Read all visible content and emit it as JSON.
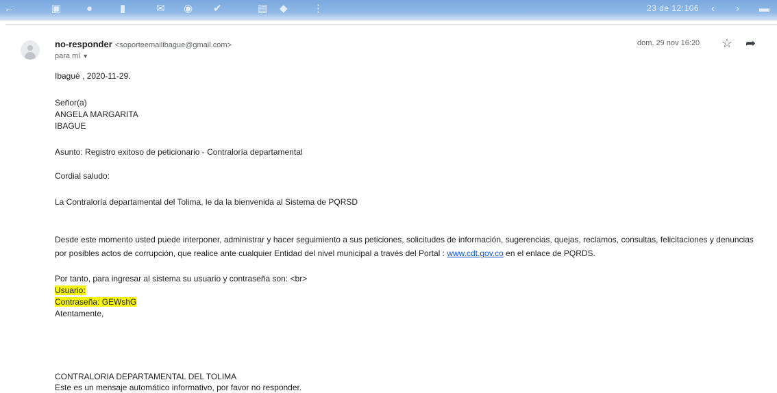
{
  "toolbar": {
    "date_label": "23 de 12:106",
    "icons": [
      "back-arrow-icon",
      "archive-icon",
      "spam-icon",
      "delete-icon",
      "mail-icon",
      "clock-icon",
      "add-task-icon",
      "move-to-icon",
      "label-icon",
      "more-icon",
      "prev-icon",
      "next-icon",
      "keyboard-icon"
    ]
  },
  "message": {
    "sender_name": "no-responder",
    "sender_email": "<soporteemailibague@gmail.com>",
    "to_label": "para mí",
    "date": "dom, 29 nov 16:20"
  },
  "body": {
    "line_date": "Ibagué , 2020-11-29.",
    "line_salutation": "Señor(a)",
    "line_name": "ANGELA MARGARITA",
    "line_city": "IBAGUE",
    "line_subject": "Asunto: Registro exitoso de peticionario - Contraloría departamental",
    "line_greeting": "Cordial saludo:",
    "line_welcome": "La Contraloría departamental del Tolima, le da la bienvenida al Sistema de PQRSD",
    "para_main_1": "Desde este momento usted puede interponer, administrar y hacer seguimiento a sus peticiones, solicitudes de información, sugerencias, quejas, reclamos, consultas, felicitaciones y denuncias por posibles actos de corrupción, que realice ante cualquier Entidad del nivel municipal a través del Portal : ",
    "portal_link": "www.cdt.gov.co",
    "para_main_2": " en el enlace de PQRDS.",
    "line_credentials": "Por tanto, para ingresar al sistema su usuario y contraseña son: <br>",
    "line_user": "Usuario:",
    "line_password": "Contraseña: GEWshG",
    "line_closing": "Atentamente,",
    "line_org": "CONTRALORIA DEPARTAMENTAL DEL TOLIMA",
    "line_auto": "Este es un mensaje automático informativo, por favor no responder."
  },
  "colors": {
    "toolbar": "#8fb8e6",
    "highlight": "#f6f30f",
    "link": "#1155cc"
  }
}
